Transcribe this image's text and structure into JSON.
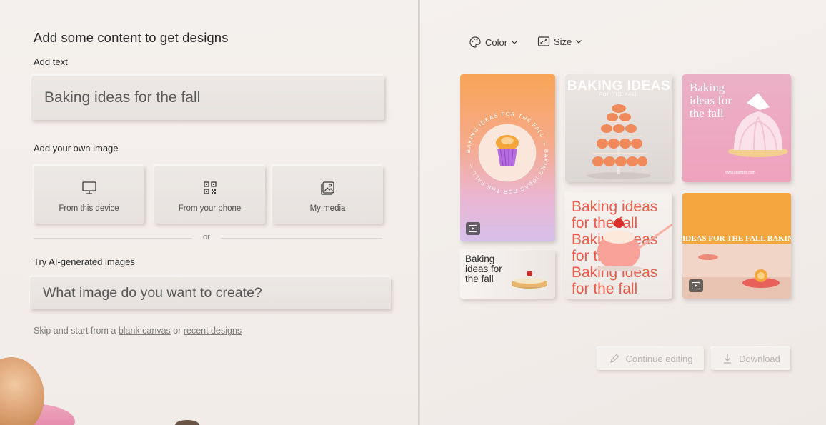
{
  "left": {
    "heading": "Add some content to get designs",
    "add_text_label": "Add text",
    "text_input_value": "Baking ideas for the fall",
    "own_image_label": "Add your own image",
    "sources": [
      {
        "label": "From this device",
        "icon": "monitor-icon"
      },
      {
        "label": "From your phone",
        "icon": "qr-code-icon"
      },
      {
        "label": "My media",
        "icon": "media-gallery-icon"
      }
    ],
    "or_text": "or",
    "ai_label": "Try AI-generated images",
    "ai_placeholder": "What image do you want to create?",
    "skip_prefix": "Skip and start from a ",
    "skip_blank": "blank canvas",
    "skip_middle": " or ",
    "skip_recent": "recent designs"
  },
  "toolbar": {
    "color_label": "Color",
    "size_label": "Size"
  },
  "designs": {
    "card2_title": "BAKING IDEAS",
    "card2_sub": "FOR THE FALL",
    "card3_title": "Baking ideas for the fall",
    "card3_url": "www.example.com",
    "card4_text": "Baking ideas for the fall",
    "card5_title": "Baking ideas for the fall",
    "card6_banner": "IDEAS FOR THE FALL   BAKING",
    "card1_ring": "BAKING IDEAS FOR THE FALL — BAKING IDEAS FOR THE FALL —"
  },
  "actions": {
    "continue_label": "Continue editing",
    "download_label": "Download"
  },
  "colors": {
    "accent_orange": "#f59a4a",
    "accent_pink": "#f0a0b8",
    "accent_red": "#ef5a4a"
  }
}
